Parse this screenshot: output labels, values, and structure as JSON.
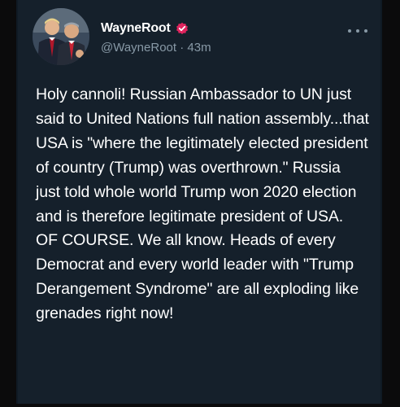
{
  "tweet": {
    "author": {
      "display_name": "WayneRoot",
      "handle": "@WayneRoot",
      "verified": true,
      "verified_color": "#e0245e"
    },
    "separator": "·",
    "time_ago": "43m",
    "text": "Holy cannoli! Russian Ambassador to UN just said to United Nations full nation assembly...that USA is \"where the legitimately elected president of country (Trump) was overthrown.\" Russia just told whole world Trump won 2020 election and is therefore legitimate president of USA. OF COURSE. We all know. Heads of every Democrat and every world leader with \"Trump Derangement Syndrome\" are all exploding like grenades right now!",
    "more_icon": "ellipsis-icon"
  },
  "colors": {
    "background": "#15202b",
    "text": "#ffffff",
    "secondary_text": "#8899a6"
  }
}
